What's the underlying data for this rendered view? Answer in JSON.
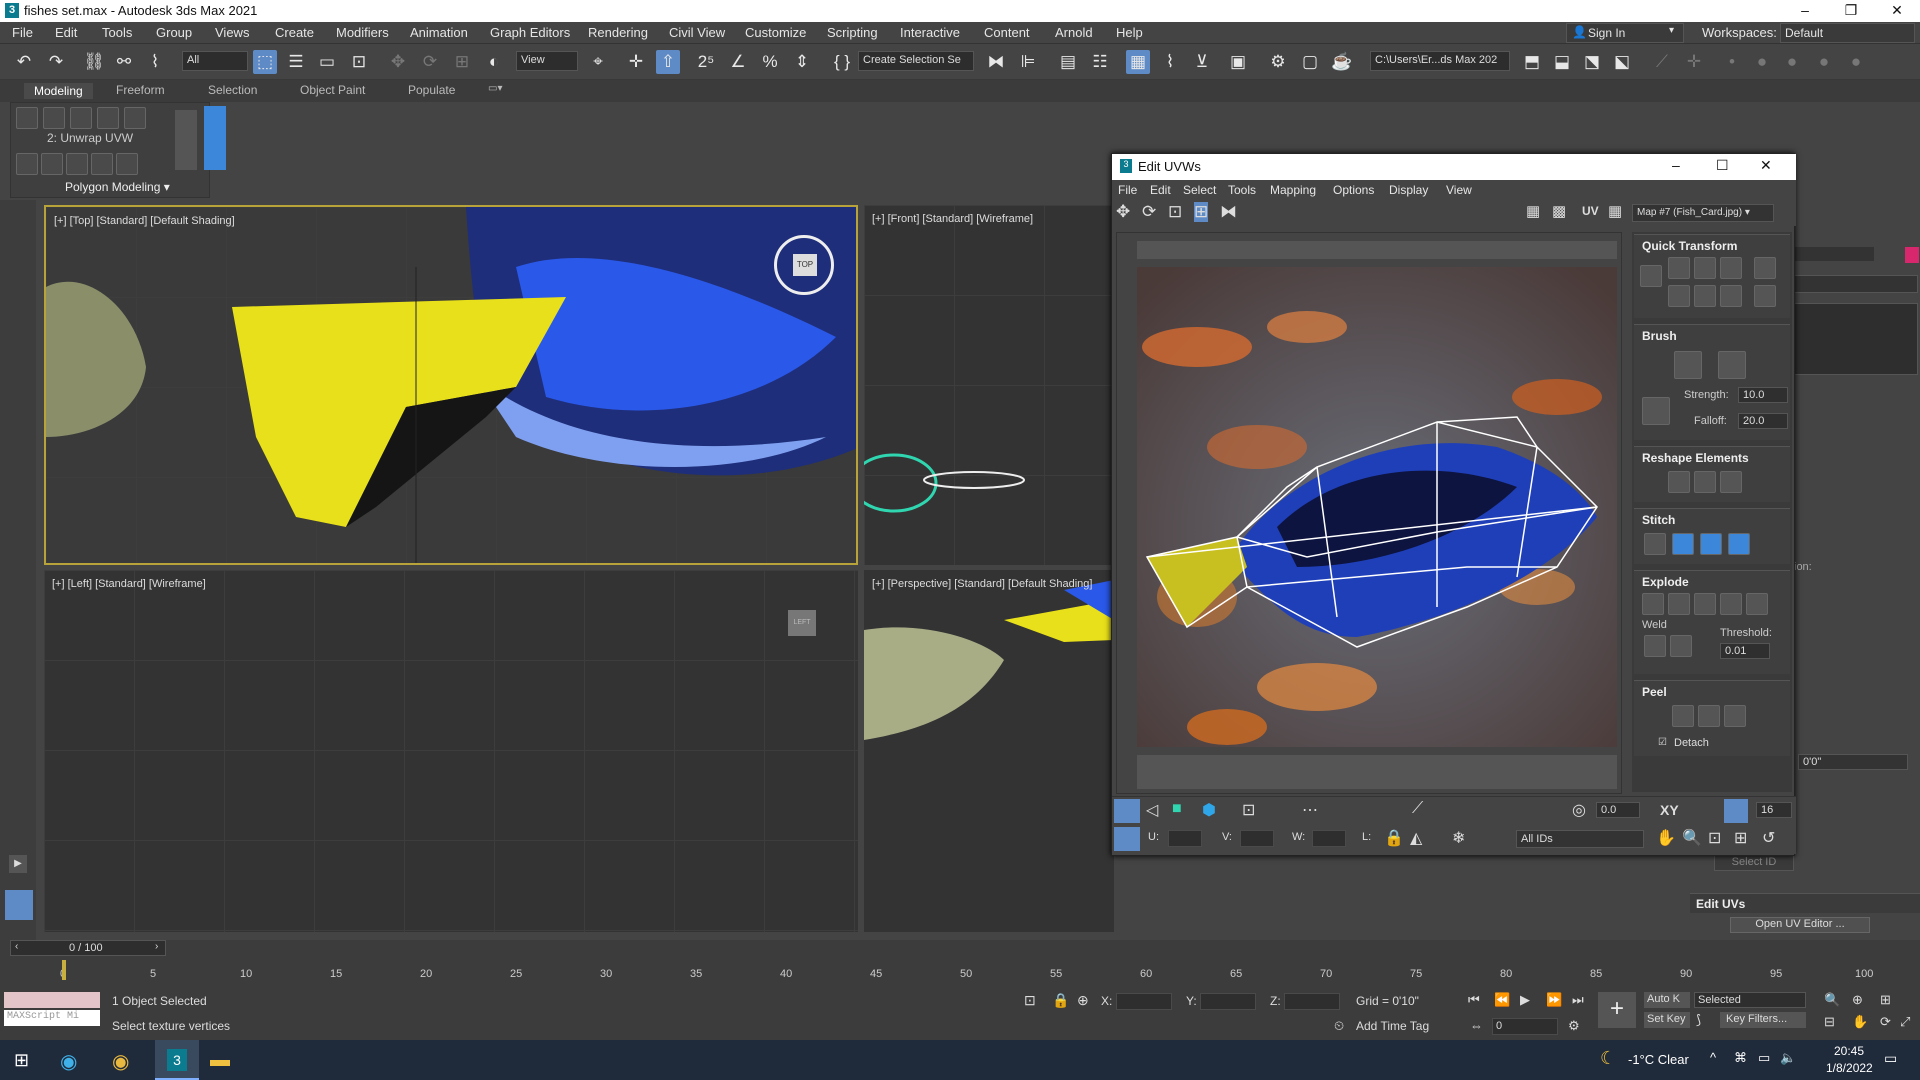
{
  "window": {
    "title": "fishes set.max - Autodesk 3ds Max 2021",
    "app_icon": "3"
  },
  "menu": [
    "File",
    "Edit",
    "Tools",
    "Group",
    "Views",
    "Create",
    "Modifiers",
    "Animation",
    "Graph Editors",
    "Rendering",
    "Civil View",
    "Customize",
    "Scripting",
    "Interactive",
    "Content",
    "Arnold",
    "Help"
  ],
  "account": {
    "sign_in": "Sign In",
    "workspaces_label": "Workspaces:",
    "workspace": "Default"
  },
  "toolbar": {
    "filter": "All",
    "view_ref": "View",
    "selection_set": "Create Selection Se",
    "path": "C:\\Users\\Er...ds Max 202"
  },
  "ribbon": {
    "tabs": [
      "Modeling",
      "Freeform",
      "Selection",
      "Object Paint",
      "Populate"
    ],
    "modifier_label": "2: Unwrap UVW",
    "group": "Polygon Modeling"
  },
  "viewports": {
    "top": "[+] [Top] [Standard] [Default Shading]",
    "front": "[+] [Front] [Standard] [Wireframe]",
    "left": "[+] [Left] [Standard] [Wireframe]",
    "perspective": "[+] [Perspective] [Standard] [Default Shading]",
    "viewcube_top": "TOP",
    "viewcube_left": "LEFT"
  },
  "uv_editor": {
    "title": "Edit UVWs",
    "menu": [
      "File",
      "Edit",
      "Select",
      "Tools",
      "Mapping",
      "Options",
      "Display",
      "View"
    ],
    "uv_label": "UV",
    "map": "Map #7 (Fish_Card.jpg)",
    "rollouts": {
      "quick_transform": "Quick Transform",
      "brush": "Brush",
      "strength_label": "Strength:",
      "strength": "10.0",
      "falloff_label": "Falloff:",
      "falloff": "20.0",
      "reshape": "Reshape Elements",
      "stitch": "Stitch",
      "explode": "Explode",
      "weld": "Weld",
      "threshold_label": "Threshold:",
      "threshold": "0.01",
      "peel": "Peel",
      "detach": "Detach"
    },
    "bottom": {
      "angle": "0.0",
      "xy": "XY",
      "grid": "16",
      "u": "U:",
      "v": "V:",
      "w": "W:",
      "l": "L:",
      "ids": "All IDs"
    }
  },
  "command_panel": {
    "select_id": "Select ID",
    "edit_uvs": "Edit UVs",
    "open_editor": "Open UV Editor ...",
    "angle": "0'0\"",
    "label_on": "ion:"
  },
  "timeline": {
    "frame": "0 / 100",
    "ticks": [
      "0",
      "5",
      "10",
      "15",
      "20",
      "25",
      "30",
      "35",
      "40",
      "45",
      "50",
      "55",
      "60",
      "65",
      "70",
      "75",
      "80",
      "85",
      "90",
      "95",
      "100"
    ]
  },
  "status": {
    "selected": "1 Object Selected",
    "hint": "Select texture vertices",
    "maxscript": "MAXScript Mi",
    "x": "X:",
    "y": "Y:",
    "z": "Z:",
    "grid": "Grid = 0'10\"",
    "time_tag": "Add Time Tag",
    "auto_key": "Auto K",
    "selected_dd": "Selected",
    "set_key": "Set Key",
    "key_filters": "Key Filters...",
    "frame_field": "0"
  },
  "taskbar": {
    "weather": "-1°C  Clear",
    "time": "20:45",
    "date": "1/8/2022"
  },
  "colors": {
    "accent": "#5e8bc6",
    "fish_blue": "#1f3fb8",
    "fish_yellow": "#e8e01a",
    "title_bg": "#ffffff"
  }
}
